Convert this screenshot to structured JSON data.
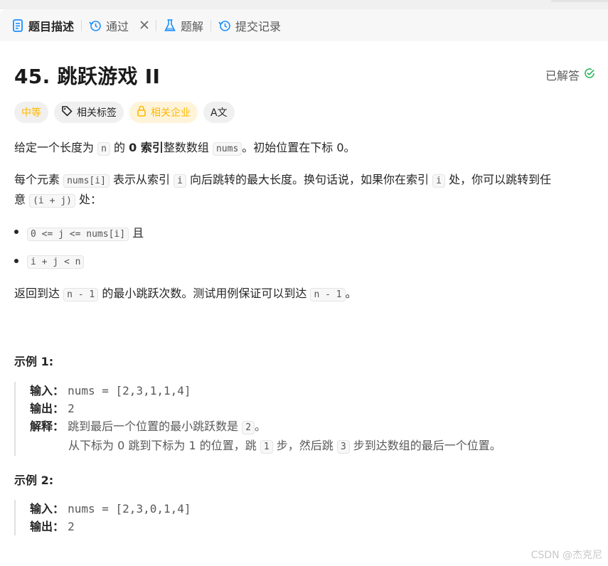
{
  "tabs": [
    {
      "label": "题目描述",
      "icon": "document-icon",
      "active": true
    },
    {
      "label": "通过",
      "icon": "history-icon",
      "active": false
    },
    {
      "label": "题解",
      "icon": "flask-icon",
      "active": false
    },
    {
      "label": "提交记录",
      "icon": "history-icon",
      "active": false
    }
  ],
  "problem": {
    "title": "45. 跳跃游戏 II",
    "status": "已解答"
  },
  "tags": {
    "difficulty": "中等",
    "related_tags": "相关标签",
    "related_companies": "相关企业",
    "translate": "A文"
  },
  "description": {
    "p1": {
      "a": "给定一个长度为",
      "n": "n",
      "b": "的",
      "bold": "0 索引",
      "c": "整数数组",
      "nums": "nums",
      "d": "。初始位置在下标 0。"
    },
    "p2": {
      "a": "每个元素",
      "code1": "nums[i]",
      "b": "表示从索引",
      "code2": "i",
      "c": "向后跳转的最大长度。换句话说，如果你在索引",
      "code3": "i",
      "d": "处，你可以跳转到任",
      "e": "意",
      "code4": "(i + j)",
      "f": "处："
    },
    "bullets": [
      {
        "code": "0 <= j <= nums[i]",
        "suffix": "且"
      },
      {
        "code": "i + j < n",
        "suffix": ""
      }
    ],
    "p3": {
      "a": "返回到达",
      "code1": "n - 1",
      "b": "的最小跳跃次数。测试用例保证可以到达",
      "code2": "n - 1",
      "c": "。"
    }
  },
  "examples": [
    {
      "heading": "示例 1:",
      "input_label": "输入：",
      "input": "nums = [2,3,1,1,4]",
      "output_label": "输出：",
      "output": "2",
      "explain_label": "解释：",
      "explain1": {
        "a": "跳到最后一个位置的最小跳跃数是",
        "code": "2",
        "b": "。"
      },
      "explain2": {
        "a": "从下标为 0 跳到下标为 1 的位置，跳",
        "code1": "1",
        "b": "步，然后跳",
        "code2": "3",
        "c": "步到达数组的最后一个位置。"
      }
    },
    {
      "heading": "示例 2:",
      "input_label": "输入：",
      "input": "nums = [2,3,0,1,4]",
      "output_label": "输出：",
      "output": "2"
    }
  ],
  "watermark": "CSDN @杰克尼",
  "colors": {
    "accent": "#1a90ff",
    "solved": "#2db55d",
    "difficulty": "#ffb800"
  }
}
